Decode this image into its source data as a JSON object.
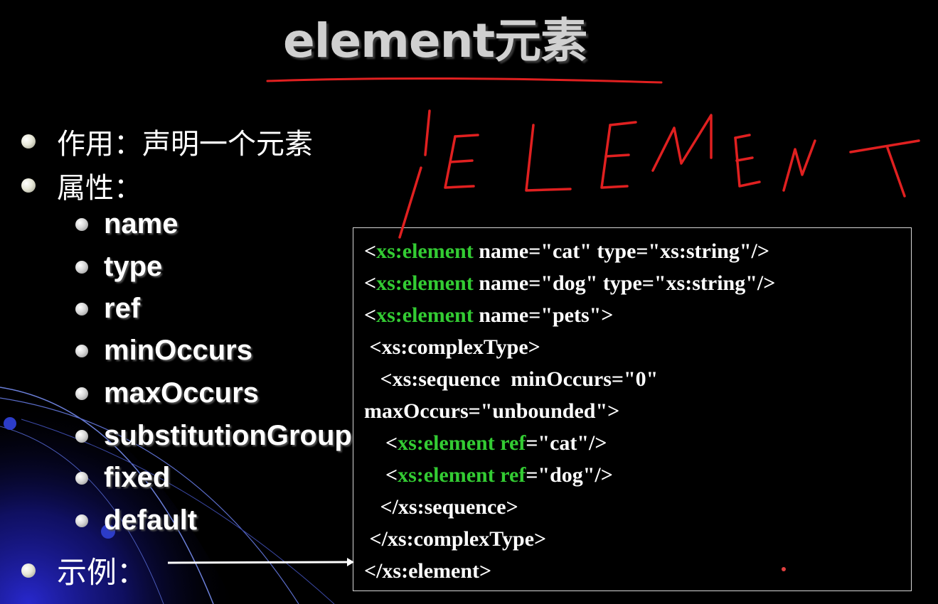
{
  "title": "element元素",
  "bullets": [
    {
      "text": "作用：声明一个元素"
    },
    {
      "text": "属性："
    }
  ],
  "attributes": [
    "name",
    "type",
    "ref",
    "minOccurs",
    "maxOccurs",
    "substitutionGroup",
    "fixed",
    "default"
  ],
  "example_label": "示例：",
  "handwritten_annotation": "ELEMENT",
  "code": {
    "line1": {
      "p1": "<",
      "g1": "xs:element",
      "p2": " name=\"cat\" type=\"xs:string\"/>"
    },
    "line2": {
      "p1": "<",
      "g1": "xs:element",
      "p2": " name=\"dog\" type=\"xs:string\"/>"
    },
    "line3": {
      "p1": "<",
      "g1": "xs:element",
      "p2": " name=\"pets\">"
    },
    "line4": {
      "p1": " <xs:complexType>"
    },
    "line5": {
      "p1": "   <xs:sequence  minOccurs=\"0\""
    },
    "line6": {
      "p1": "maxOccurs=\"unbounded\">"
    },
    "line7": {
      "p1": "    <",
      "g1": "xs:element",
      "p2": " ",
      "g2": "ref",
      "p3": "=\"cat\"/>"
    },
    "line8": {
      "p1": "    <",
      "g1": "xs:element",
      "p2": " ",
      "g2": "ref",
      "p3": "=\"dog\"/>"
    },
    "line9": {
      "p1": "   </xs:sequence>"
    },
    "line10": {
      "p1": " </xs:complexType>"
    },
    "line11": {
      "p1": "</xs:element>"
    }
  },
  "colors": {
    "background": "#000000",
    "keyword": "#33cc33",
    "text": "#ffffff",
    "annotation": "#e02020"
  }
}
